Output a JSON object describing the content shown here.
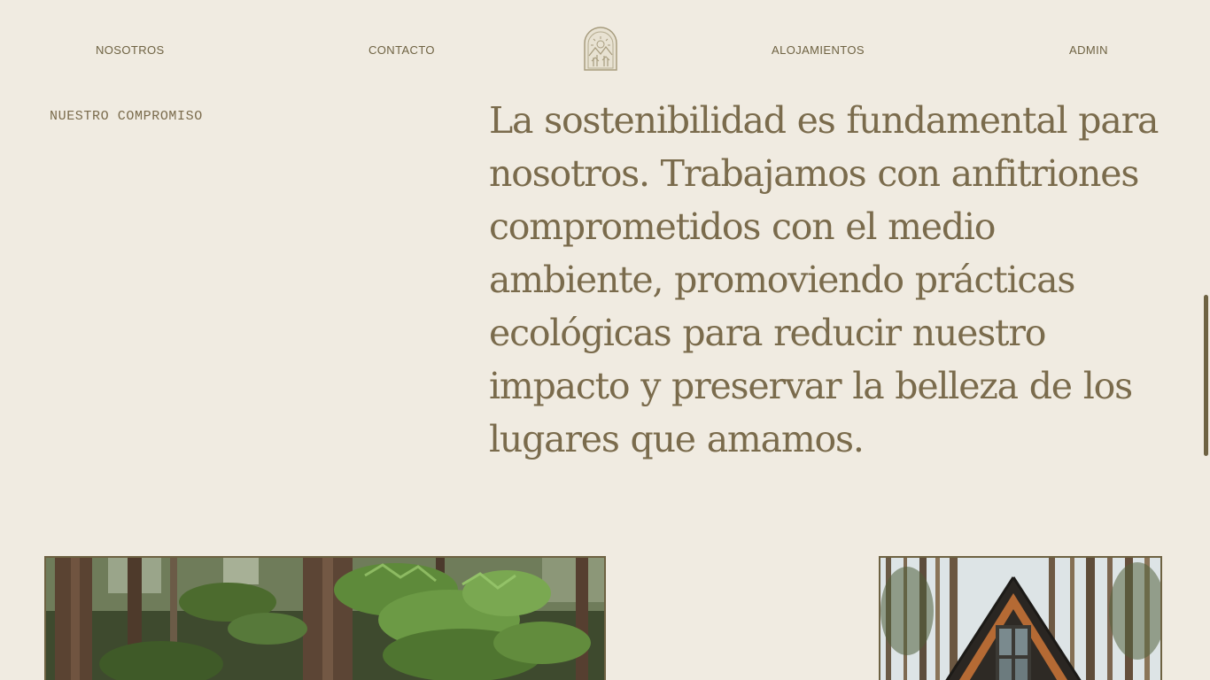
{
  "nav": {
    "items": [
      {
        "label": "NOSOTROS"
      },
      {
        "label": "CONTACTO"
      },
      {
        "label": "ALOJAMIENTOS"
      },
      {
        "label": "ADMIN"
      }
    ],
    "logo_icon": "cabin-arch-logo-icon"
  },
  "commitment": {
    "label": "NUESTRO COMPROMISO",
    "text": "La sostenibilidad es fundamental para nosotros. Trabajamos con anfitriones comprometidos con el medio ambiente, promoviendo prácticas ecológicas para reducir nuestro impacto y preservar la belleza de los lugares que amamos."
  },
  "gallery": {
    "images": [
      {
        "icon": "forest-photo"
      },
      {
        "icon": "a-frame-cabin-photo"
      }
    ]
  },
  "colors": {
    "background": "#F0EBE1",
    "accent": "#7A6B4C",
    "border": "#6E6242"
  }
}
